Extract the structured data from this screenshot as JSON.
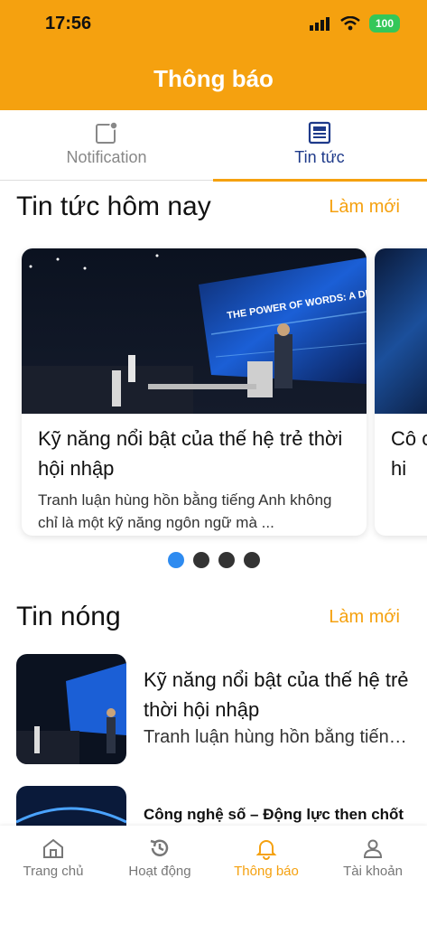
{
  "status_bar": {
    "time": "17:56",
    "battery": "100"
  },
  "header": {
    "title": "Thông báo"
  },
  "tabs": [
    {
      "label": "Notification",
      "icon": "notification-square-icon",
      "active": false
    },
    {
      "label": "Tin tức",
      "icon": "newspaper-icon",
      "active": true
    }
  ],
  "today_news": {
    "title": "Tin tức hôm nay",
    "action": "Làm mới",
    "cards": [
      {
        "image_text": "THE POWER OF WORDS: A DEBATE ON AI & SOCIETY",
        "title": "Kỹ năng nổi bật của thế hệ trẻ thời hội nhập",
        "description": "Tranh luận hùng hồn bằng tiếng Anh không chỉ là một kỹ năng ngôn ngữ mà ..."
      },
      {
        "title_fragment": "Cô ch hi",
        "description_fragment": "Cô"
      }
    ],
    "pagination": {
      "count": 4,
      "active": 0
    }
  },
  "hot_news": {
    "title": "Tin nóng",
    "action": "Làm mới",
    "items": [
      {
        "title": "Kỹ năng nổi bật của thế hệ trẻ thời hội nhập",
        "description": "Tranh luận hùng hồn bằng tiếng Anh không chỉ là một kỹ năng ngôn ngữ mà ..."
      },
      {
        "title": "Công nghệ số – Động lực then chốt"
      }
    ]
  },
  "bottom_nav": [
    {
      "label": "Trang chủ",
      "icon": "home-icon",
      "active": false
    },
    {
      "label": "Hoạt động",
      "icon": "history-icon",
      "active": false
    },
    {
      "label": "Thông báo",
      "icon": "bell-icon",
      "active": true
    },
    {
      "label": "Tài khoản",
      "icon": "user-icon",
      "active": false
    }
  ],
  "colors": {
    "accent": "#F5A10F",
    "tab_active": "#1E3A8A",
    "dot_active": "#2E8BF0",
    "battery": "#34C759"
  }
}
